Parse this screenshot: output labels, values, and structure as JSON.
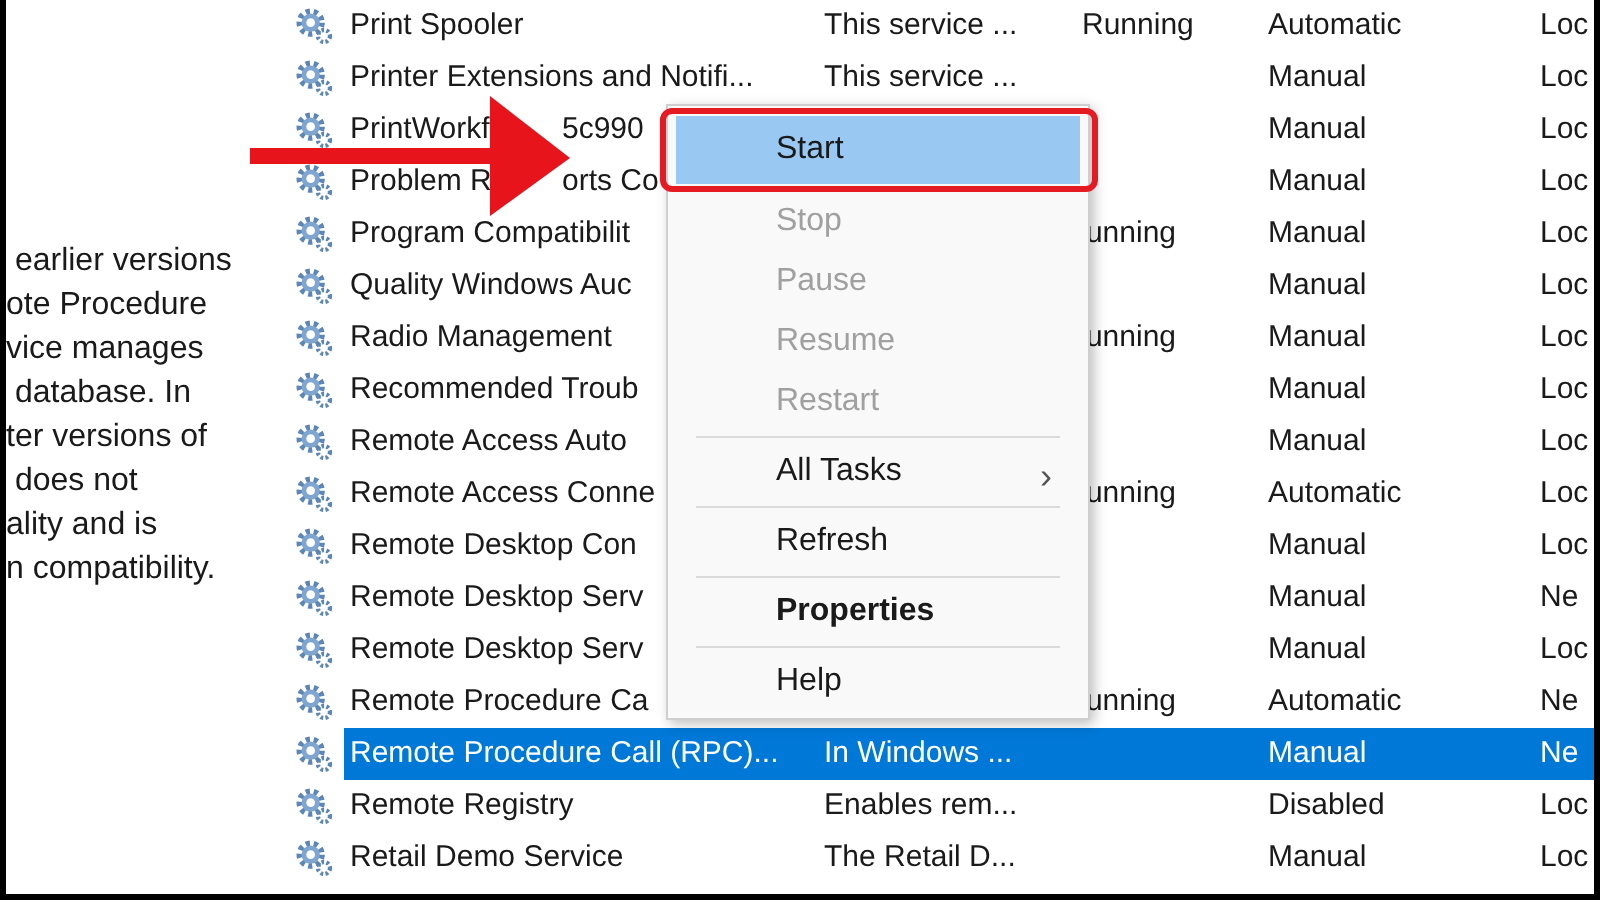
{
  "description_pane": {
    "text": " earlier versions\note Procedure\nvice manages\n database. In\nter versions of\n does not\nality and is\nn compatibility."
  },
  "services": [
    {
      "name": "Print Spooler",
      "description": "This service ...",
      "status": "Running",
      "startup_type": "Automatic",
      "log_on_as": "Loc",
      "selected": false
    },
    {
      "name": "Printer Extensions and Notifi...",
      "description": "This service ...",
      "startup_type": "Manual",
      "log_on_as": "Loc",
      "selected": false
    },
    {
      "name": "PrintWorkf",
      "name_tail": "5c990",
      "startup_type": "Manual",
      "log_on_as": "Loc",
      "selected": false
    },
    {
      "name": "Problem R",
      "name_tail": "orts Co",
      "startup_type": "Manual",
      "log_on_as": "Loc",
      "selected": false
    },
    {
      "name": "Program Compatibilit",
      "status": "unning",
      "startup_type": "Manual",
      "log_on_as": "Loc",
      "selected": false
    },
    {
      "name": "Quality Windows Auc",
      "startup_type": "Manual",
      "log_on_as": "Loc",
      "selected": false
    },
    {
      "name": "Radio Management",
      "status": "unning",
      "startup_type": "Manual",
      "log_on_as": "Loc",
      "selected": false
    },
    {
      "name": "Recommended Troub",
      "startup_type": "Manual",
      "log_on_as": "Loc",
      "selected": false
    },
    {
      "name": "Remote Access Auto",
      "startup_type": "Manual",
      "log_on_as": "Loc",
      "selected": false
    },
    {
      "name": "Remote Access Conne",
      "status": "unning",
      "startup_type": "Automatic",
      "log_on_as": "Loc",
      "selected": false
    },
    {
      "name": "Remote Desktop Con",
      "startup_type": "Manual",
      "log_on_as": "Loc",
      "selected": false
    },
    {
      "name": "Remote Desktop Serv",
      "startup_type": "Manual",
      "log_on_as": "Ne",
      "selected": false
    },
    {
      "name": "Remote Desktop Serv",
      "startup_type": "Manual",
      "log_on_as": "Loc",
      "selected": false
    },
    {
      "name": "Remote Procedure Ca",
      "status": "unning",
      "startup_type": "Automatic",
      "log_on_as": "Ne",
      "selected": false
    },
    {
      "name": "Remote Procedure Call (RPC)...",
      "description": "In Windows ...",
      "startup_type": "Manual",
      "log_on_as": "Ne",
      "selected": true
    },
    {
      "name": "Remote Registry",
      "description": "Enables rem...",
      "startup_type": "Disabled",
      "log_on_as": "Loc",
      "selected": false
    },
    {
      "name": "Retail Demo Service",
      "description": "The Retail D...",
      "startup_type": "Manual",
      "log_on_as": "Loc",
      "selected": false
    }
  ],
  "context_menu": [
    {
      "kind": "item",
      "label": "Start",
      "selected": true,
      "disabled": false,
      "bold": false
    },
    {
      "kind": "item",
      "label": "Stop",
      "selected": false,
      "disabled": true,
      "bold": false
    },
    {
      "kind": "item",
      "label": "Pause",
      "selected": false,
      "disabled": true,
      "bold": false
    },
    {
      "kind": "item",
      "label": "Resume",
      "selected": false,
      "disabled": true,
      "bold": false
    },
    {
      "kind": "item",
      "label": "Restart",
      "selected": false,
      "disabled": true,
      "bold": false
    },
    {
      "kind": "separator"
    },
    {
      "kind": "submenu",
      "label": "All Tasks",
      "arrow": "›",
      "selected": false,
      "disabled": false,
      "bold": false
    },
    {
      "kind": "separator"
    },
    {
      "kind": "item",
      "label": "Refresh",
      "selected": false,
      "disabled": false,
      "bold": false
    },
    {
      "kind": "separator"
    },
    {
      "kind": "item",
      "label": "Properties",
      "selected": false,
      "disabled": false,
      "bold": true
    },
    {
      "kind": "separator"
    },
    {
      "kind": "item",
      "label": "Help",
      "selected": false,
      "disabled": false,
      "bold": false
    }
  ],
  "annotation": {
    "arrow": true,
    "highlight_frame": true
  }
}
